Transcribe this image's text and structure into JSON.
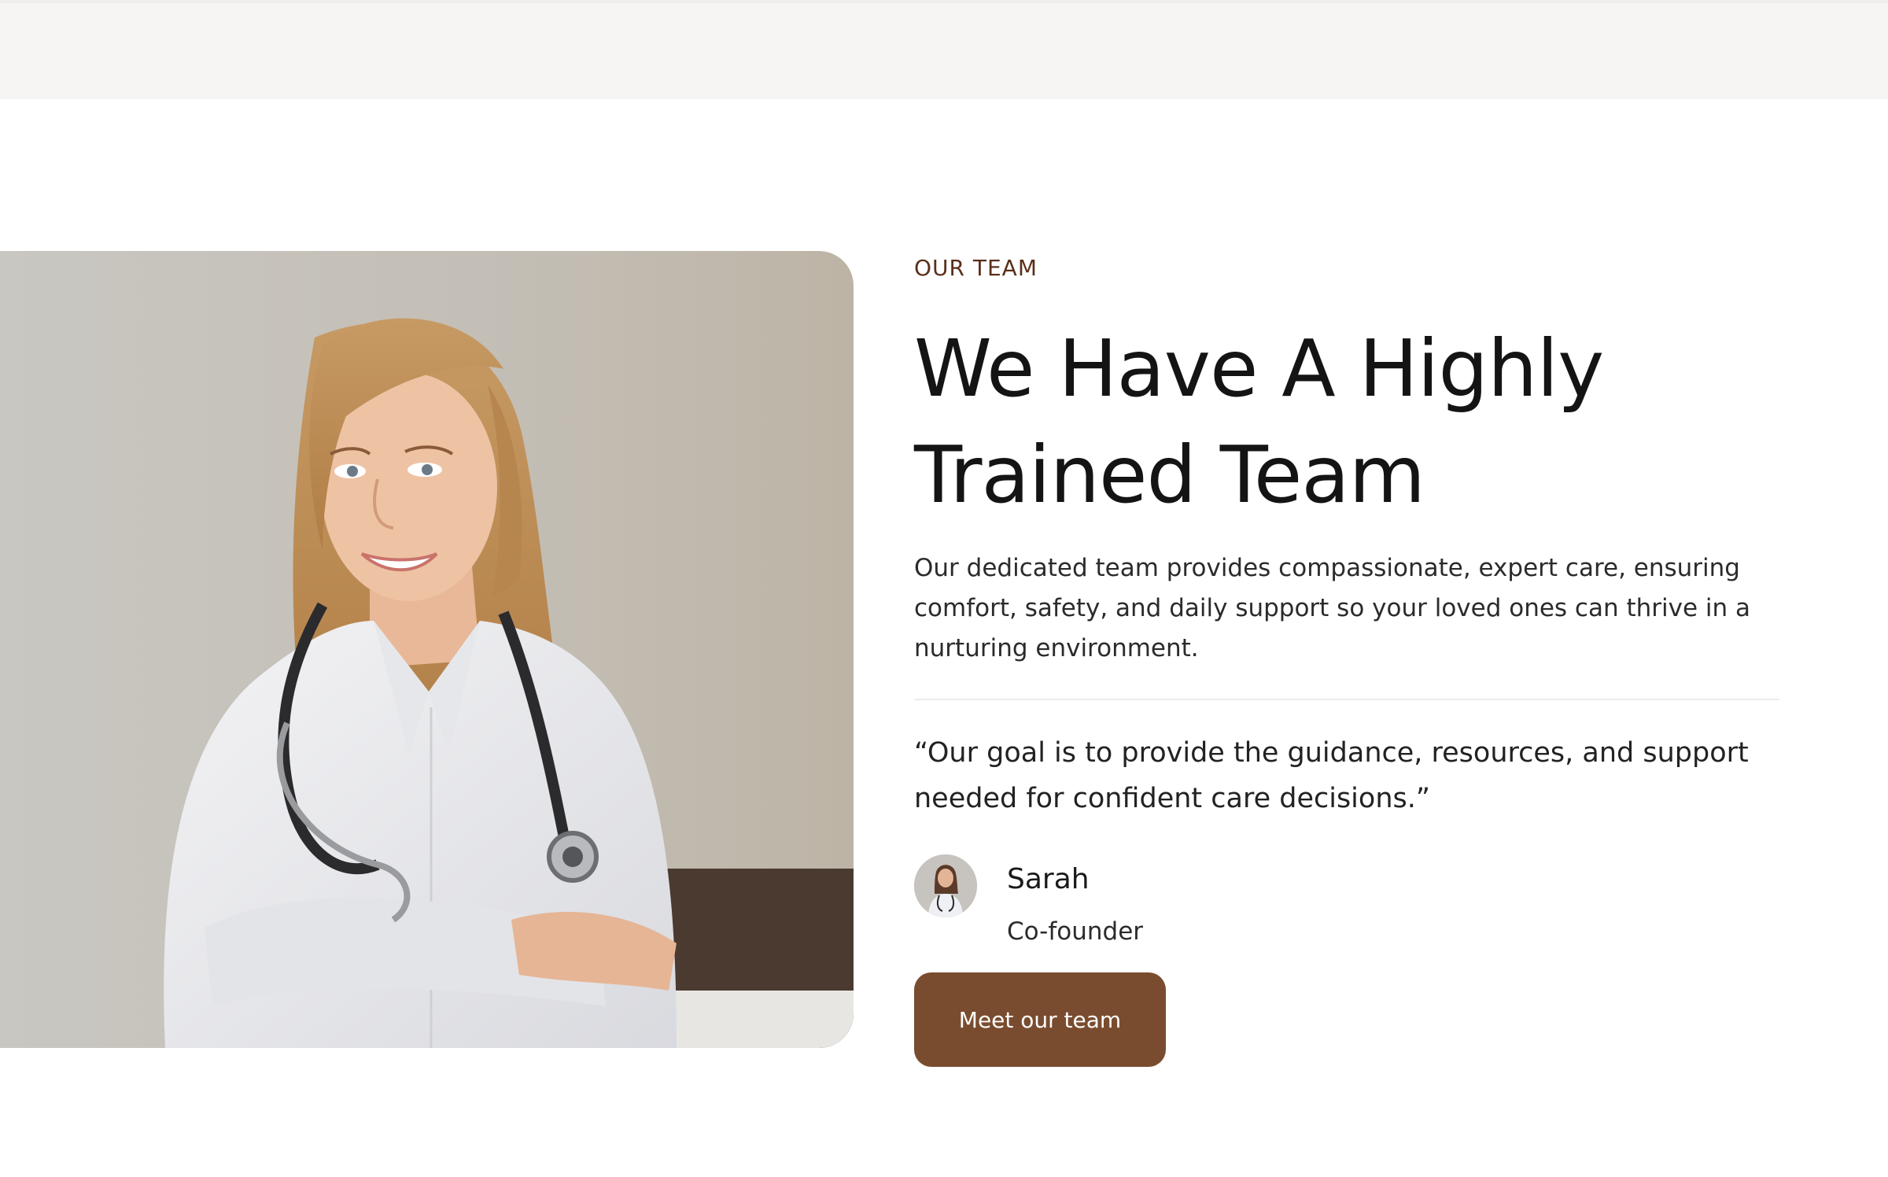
{
  "colors": {
    "accent": "#7a4c2f",
    "eyebrow": "#5a2f1a",
    "headline": "#141414",
    "body_text": "#2b2b2b",
    "top_band": "#f6f5f3"
  },
  "hero_image": {
    "icon": "doctor-portrait-photo"
  },
  "section": {
    "eyebrow": "OUR TEAM",
    "headline": "We Have A Highly Trained Team",
    "description": "Our dedicated team provides compassionate, expert care, ensuring comfort, safety, and daily support so your loved ones can thrive in a nurturing environment.",
    "quote": "“Our goal is to provide the guidance, resources, and support needed for confident care decisions.”"
  },
  "author": {
    "name": "Sarah",
    "role": "Co-founder",
    "avatar_icon": "avatar-photo"
  },
  "cta": {
    "label": "Meet our team"
  }
}
